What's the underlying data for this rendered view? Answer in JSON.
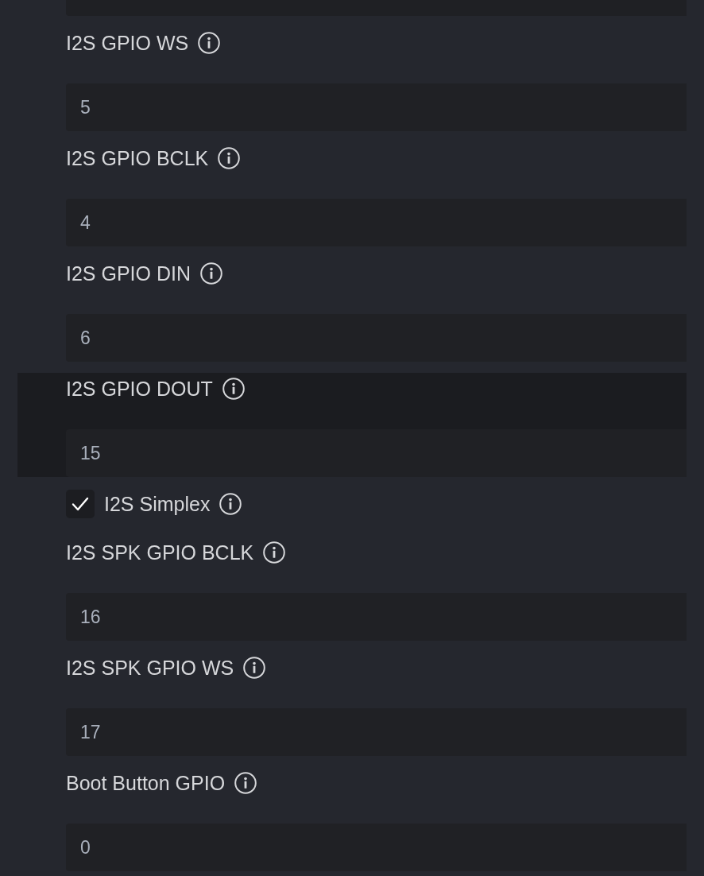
{
  "fields": [
    {
      "kind": "text",
      "label": "I2S GPIO WS",
      "value": "5",
      "highlighted": false
    },
    {
      "kind": "text",
      "label": "I2S GPIO BCLK",
      "value": "4",
      "highlighted": false
    },
    {
      "kind": "text",
      "label": "I2S GPIO DIN",
      "value": "6",
      "highlighted": false
    },
    {
      "kind": "text",
      "label": "I2S GPIO DOUT",
      "value": "15",
      "highlighted": true
    },
    {
      "kind": "checkbox",
      "label": "I2S Simplex",
      "checked": true,
      "highlighted": false
    },
    {
      "kind": "text",
      "label": "I2S SPK GPIO BCLK",
      "value": "16",
      "highlighted": false
    },
    {
      "kind": "text",
      "label": "I2S SPK GPIO WS",
      "value": "17",
      "highlighted": false
    },
    {
      "kind": "text",
      "label": "Boot Button GPIO",
      "value": "0",
      "highlighted": false
    }
  ]
}
